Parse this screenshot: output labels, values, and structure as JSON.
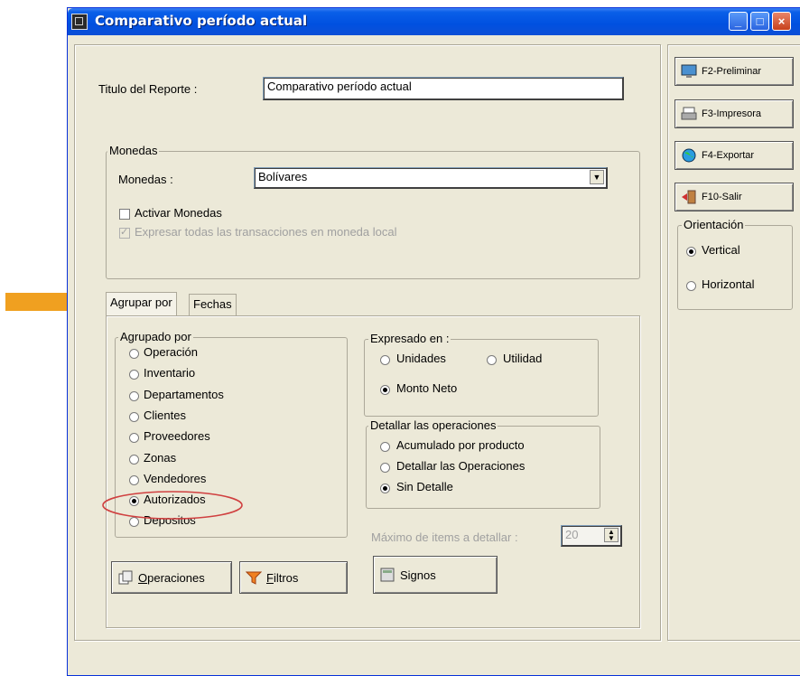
{
  "window": {
    "title": "Comparativo período actual"
  },
  "report": {
    "title_label": "Titulo del Reporte :",
    "title_value": "Comparativo período actual"
  },
  "monedas": {
    "group_label": "Monedas",
    "field_label": "Monedas :",
    "selected": "Bolívares",
    "activar_label": "Activar Monedas",
    "expresar_label": "Expresar todas las transacciones en moneda local"
  },
  "side_buttons": [
    {
      "label": "F2-Preliminar",
      "icon": "monitor-icon"
    },
    {
      "label": "F3-Impresora",
      "icon": "printer-icon"
    },
    {
      "label": "F4-Exportar",
      "icon": "globe-icon"
    },
    {
      "label": "F10-Salir",
      "icon": "exit-door-icon"
    }
  ],
  "orientacion": {
    "label": "Orientación",
    "options": [
      "Vertical",
      "Horizontal"
    ],
    "selected": "Vertical"
  },
  "tabs": [
    "Agrupar por",
    "Fechas"
  ],
  "agrupado": {
    "label": "Agrupado por",
    "options": [
      "Operación",
      "Inventario",
      "Departamentos",
      "Clientes",
      "Proveedores",
      "Zonas",
      "Vendedores",
      "Autorizados",
      "Depositos"
    ],
    "selected": "Autorizados"
  },
  "expresado": {
    "label": "Expresado en :",
    "options": [
      "Unidades",
      "Utilidad",
      "Monto Neto"
    ],
    "selected": "Monto Neto"
  },
  "detallar": {
    "label": "Detallar las operaciones",
    "options": [
      "Acumulado por producto",
      "Detallar las Operaciones",
      "Sin Detalle"
    ],
    "selected": "Sin Detalle"
  },
  "maximo": {
    "label": "Máximo de items a detallar :",
    "value": "20"
  },
  "bottom_buttons": [
    {
      "label": "Operaciones",
      "icon": "documents-icon"
    },
    {
      "label": "Filtros",
      "icon": "funnel-icon"
    },
    {
      "label": "Signos",
      "icon": "calculator-icon"
    }
  ],
  "colors": {
    "titlebar": "#0054e3",
    "arrow": "#f0a020",
    "highlight_ellipse": "#d04040",
    "face": "#ece9d8"
  }
}
